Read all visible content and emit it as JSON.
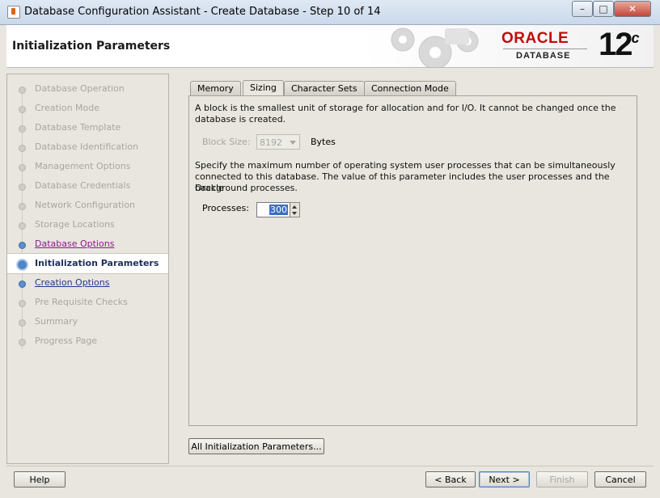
{
  "window": {
    "title": "Database Configuration Assistant - Create Database - Step 10 of 14",
    "controls": {
      "minimize": "–",
      "maximize": "□",
      "close": "✕"
    }
  },
  "header": {
    "page_title": "Initialization Parameters",
    "brand_word": "ORACLE",
    "brand_sub": "DATABASE",
    "version": "12",
    "version_suffix": "c",
    "colors": {
      "brand": "#c30a0a"
    }
  },
  "steps": [
    {
      "label": "Database Operation",
      "state": "done"
    },
    {
      "label": "Creation Mode",
      "state": "done"
    },
    {
      "label": "Database Template",
      "state": "done"
    },
    {
      "label": "Database Identification",
      "state": "done"
    },
    {
      "label": "Management Options",
      "state": "done"
    },
    {
      "label": "Database Credentials",
      "state": "done"
    },
    {
      "label": "Network Configuration",
      "state": "done"
    },
    {
      "label": "Storage Locations",
      "state": "done"
    },
    {
      "label": "Database Options",
      "state": "visited"
    },
    {
      "label": "Initialization Parameters",
      "state": "current"
    },
    {
      "label": "Creation Options",
      "state": "link"
    },
    {
      "label": "Pre Requisite Checks",
      "state": "pending"
    },
    {
      "label": "Summary",
      "state": "pending"
    },
    {
      "label": "Progress Page",
      "state": "pending"
    }
  ],
  "tabs": [
    {
      "label": "Memory",
      "active": false
    },
    {
      "label": "Sizing",
      "active": true
    },
    {
      "label": "Character Sets",
      "active": false
    },
    {
      "label": "Connection Mode",
      "active": false
    }
  ],
  "sizing": {
    "block_desc_1": "A block is the smallest unit of storage for allocation and for I/O. It cannot be changed once the",
    "block_desc_2": "database is created.",
    "block_size_label": "Block Size:",
    "block_size_value": "8192",
    "block_size_unit": "Bytes",
    "proc_desc_1": "Specify the maximum number of operating system user processes that can be simultaneously",
    "proc_desc_2": "connected to this database. The value of this parameter includes the user processes and the Oracle",
    "proc_desc_3": "background processes.",
    "processes_label": "Processes:",
    "processes_value": "300"
  },
  "buttons": {
    "all_params": "All Initialization Parameters...",
    "help": "Help",
    "back": "< Back",
    "next": "Next >",
    "finish": "Finish",
    "cancel": "Cancel"
  }
}
